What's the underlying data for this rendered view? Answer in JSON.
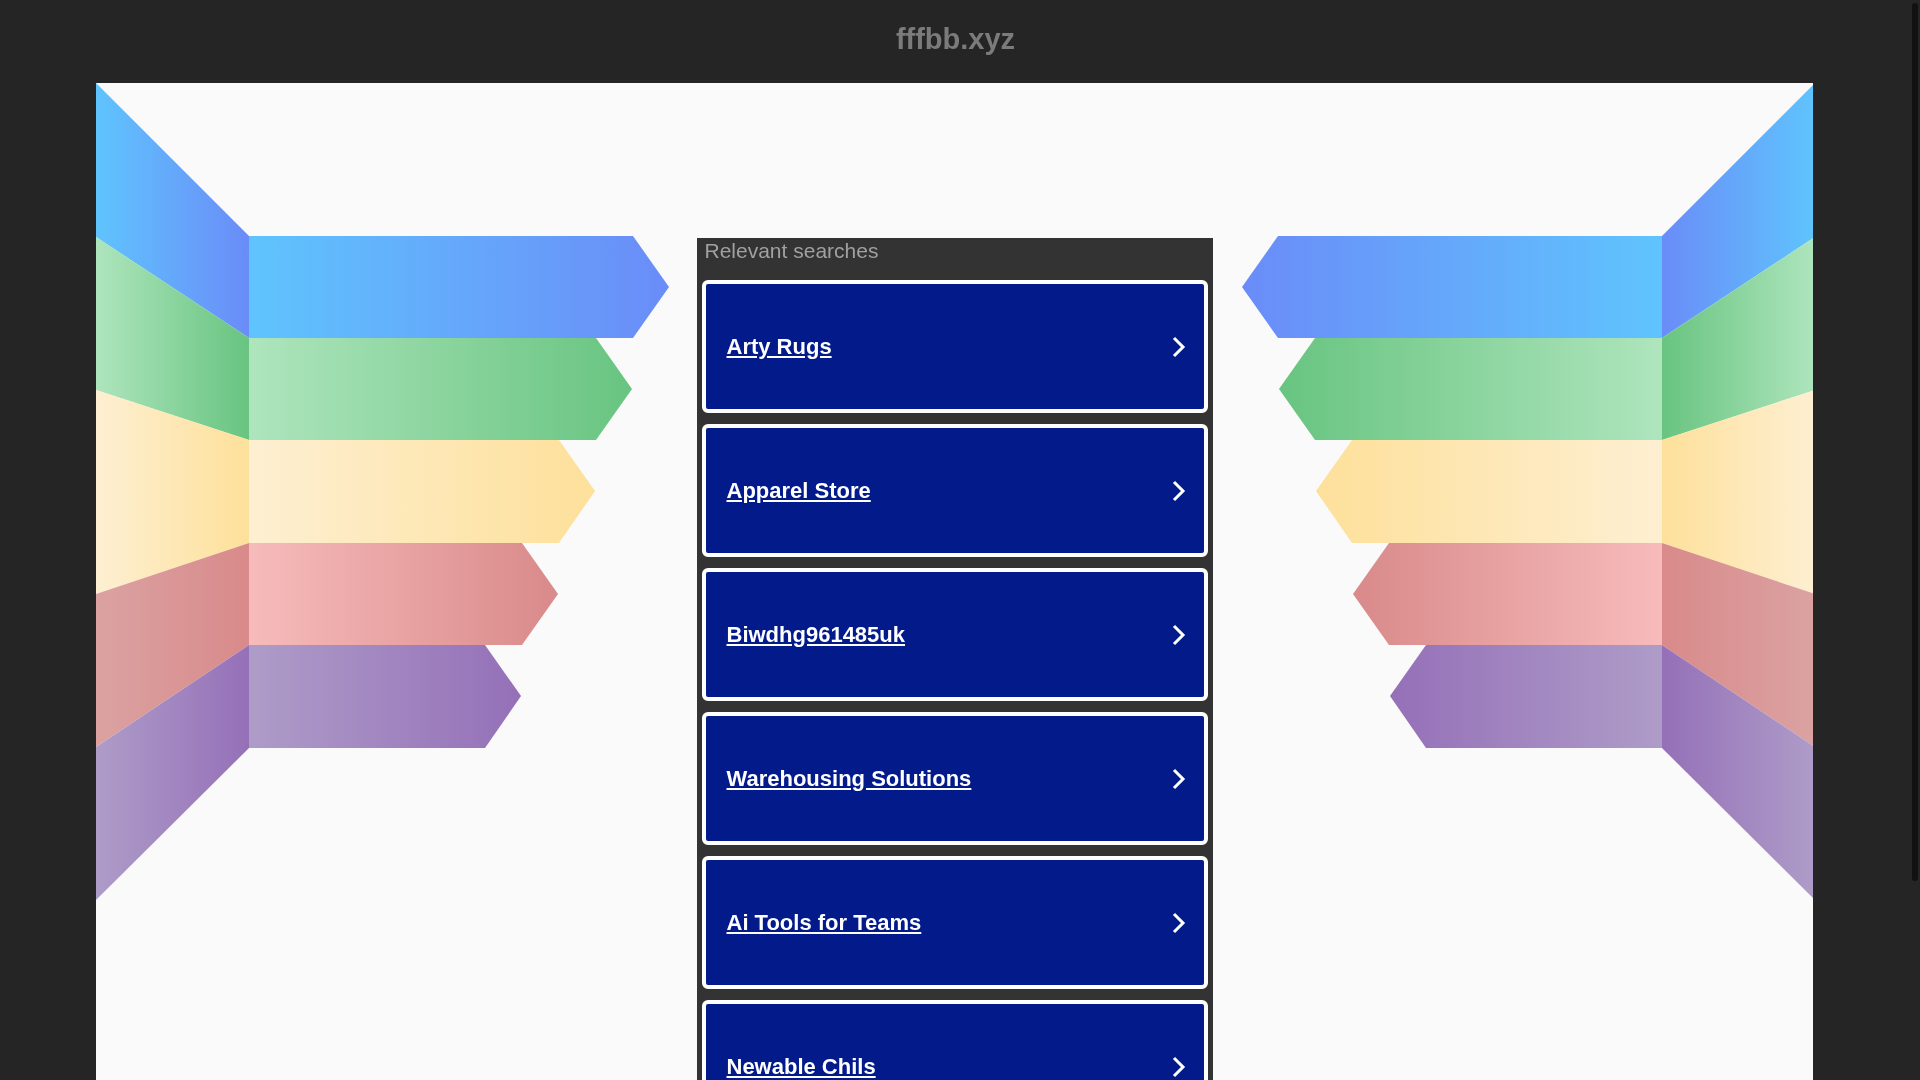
{
  "header": {
    "title": "fffbb.xyz"
  },
  "searches": {
    "heading": "Relevant searches",
    "links": [
      {
        "label": "Arty Rugs"
      },
      {
        "label": "Apparel Store"
      },
      {
        "label": "Biwdhg961485uk"
      },
      {
        "label": "Warehousing Solutions"
      },
      {
        "label": "Ai Tools for Teams"
      },
      {
        "label": "Newable Chils"
      }
    ]
  }
}
